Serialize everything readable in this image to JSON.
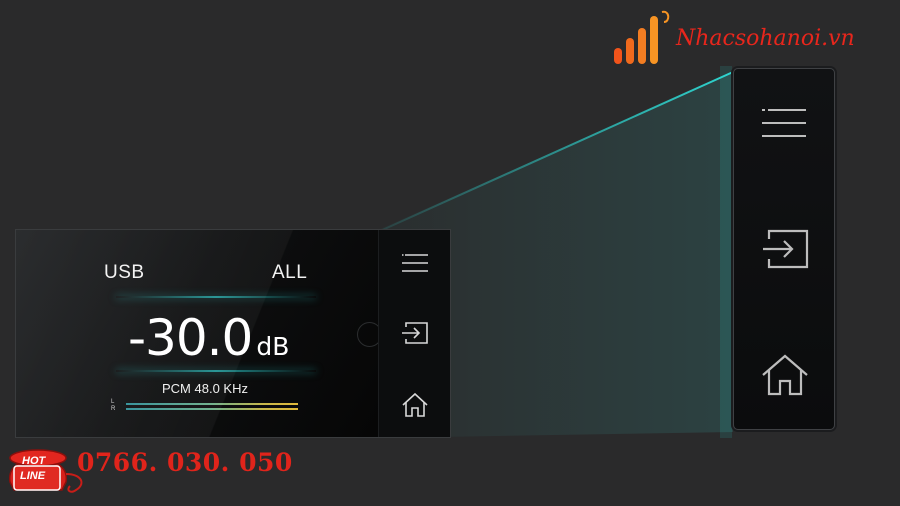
{
  "brand": {
    "name": "Nhacsohanoi.vn",
    "color": "#e8261c",
    "icon": "signal-bars-icon"
  },
  "device": {
    "source": "USB",
    "mode": "ALL",
    "volume_value": "-30.0",
    "volume_unit": "dB",
    "format": "PCM 48.0 KHz",
    "meter_left_label": "L",
    "meter_right_label": "R",
    "accent_color": "#2ee6e0",
    "side_icons": [
      "menu-icon",
      "input-icon",
      "home-icon"
    ]
  },
  "zoom_panel": {
    "icons": [
      "menu-icon",
      "input-icon",
      "home-icon"
    ]
  },
  "hotline": {
    "badge_top": "HOT",
    "badge_bottom": "LINE",
    "number": "0766. 030. 050",
    "color": "#e0241b"
  }
}
